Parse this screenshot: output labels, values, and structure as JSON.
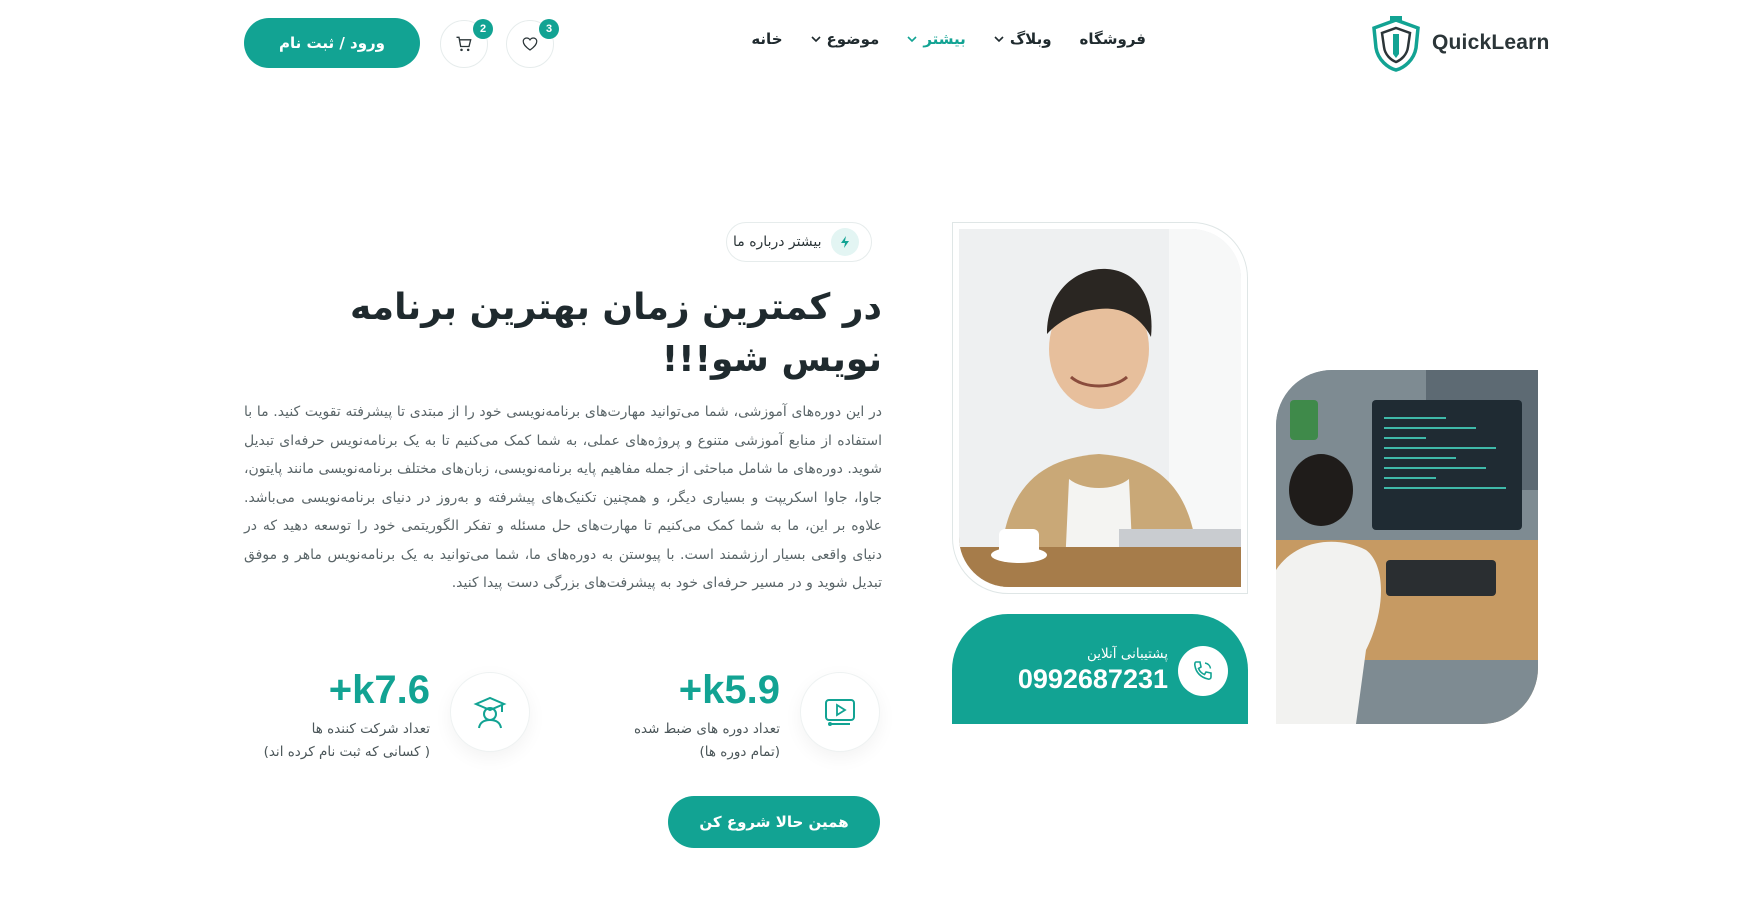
{
  "header": {
    "brand": "QuickLearn",
    "nav": [
      {
        "label": "خانه",
        "has_dropdown": false,
        "active": false
      },
      {
        "label": "موضوع",
        "has_dropdown": true,
        "active": false
      },
      {
        "label": "بیشتر",
        "has_dropdown": true,
        "active": true
      },
      {
        "label": "وبلاگ",
        "has_dropdown": true,
        "active": false
      },
      {
        "label": "فروشگاه",
        "has_dropdown": false,
        "active": false
      }
    ],
    "wishlist_count": "3",
    "cart_count": "2",
    "login_label": "ورود / ثبت نام"
  },
  "hero": {
    "tag": "بیشتر درباره ما",
    "title": "در کمترین زمان بهترین برنامه نویس شو!!!",
    "description": "در این دوره‌های آموزشی، شما می‌توانید مهارت‌های برنامه‌نویسی خود را از مبتدی تا پیشرفته تقویت کنید. ما با استفاده از منابع آموزشی متنوع و پروژه‌های عملی، به شما کمک می‌کنیم تا به یک برنامه‌نویس حرفه‌ای تبدیل شوید. دوره‌های ما شامل مباحثی از جمله مفاهیم پایه برنامه‌نویسی، زبان‌های مختلف برنامه‌نویسی مانند پایتون، جاوا، جاوا اسکریپت و بسیاری دیگر، و همچنین تکنیک‌های پیشرفته و به‌روز در دنیای برنامه‌نویسی می‌باشد. علاوه بر این، ما به شما کمک می‌کنیم تا مهارت‌های حل مسئله و تفکر الگوریتمی خود را توسعه دهید که در دنیای واقعی بسیار ارزشمند است. با پیوستن به دوره‌های ما، شما می‌توانید به یک برنامه‌نویس ماهر و موفق تبدیل شوید و در مسیر حرفه‌ای خود به پیشرفت‌های بزرگی دست پیدا کنید.",
    "stats": [
      {
        "value": "+k5.9",
        "label_line1": "تعداد دوره های ضبط شده",
        "label_line2": "(تمام دوره ها)",
        "icon": "video-course-icon"
      },
      {
        "value": "+k7.6",
        "label_line1": "تعداد شرکت کننده ها",
        "label_line2": "( کسانی که ثبت نام کرده اند)",
        "icon": "graduate-icon"
      }
    ],
    "cta_label": "همین حالا شروع کن",
    "support": {
      "label": "پشتیبانی آنلاین",
      "phone": "0992687231"
    }
  },
  "colors": {
    "accent": "#12a393",
    "text_dark": "#1f2a2e",
    "text_muted": "#5b6669"
  }
}
